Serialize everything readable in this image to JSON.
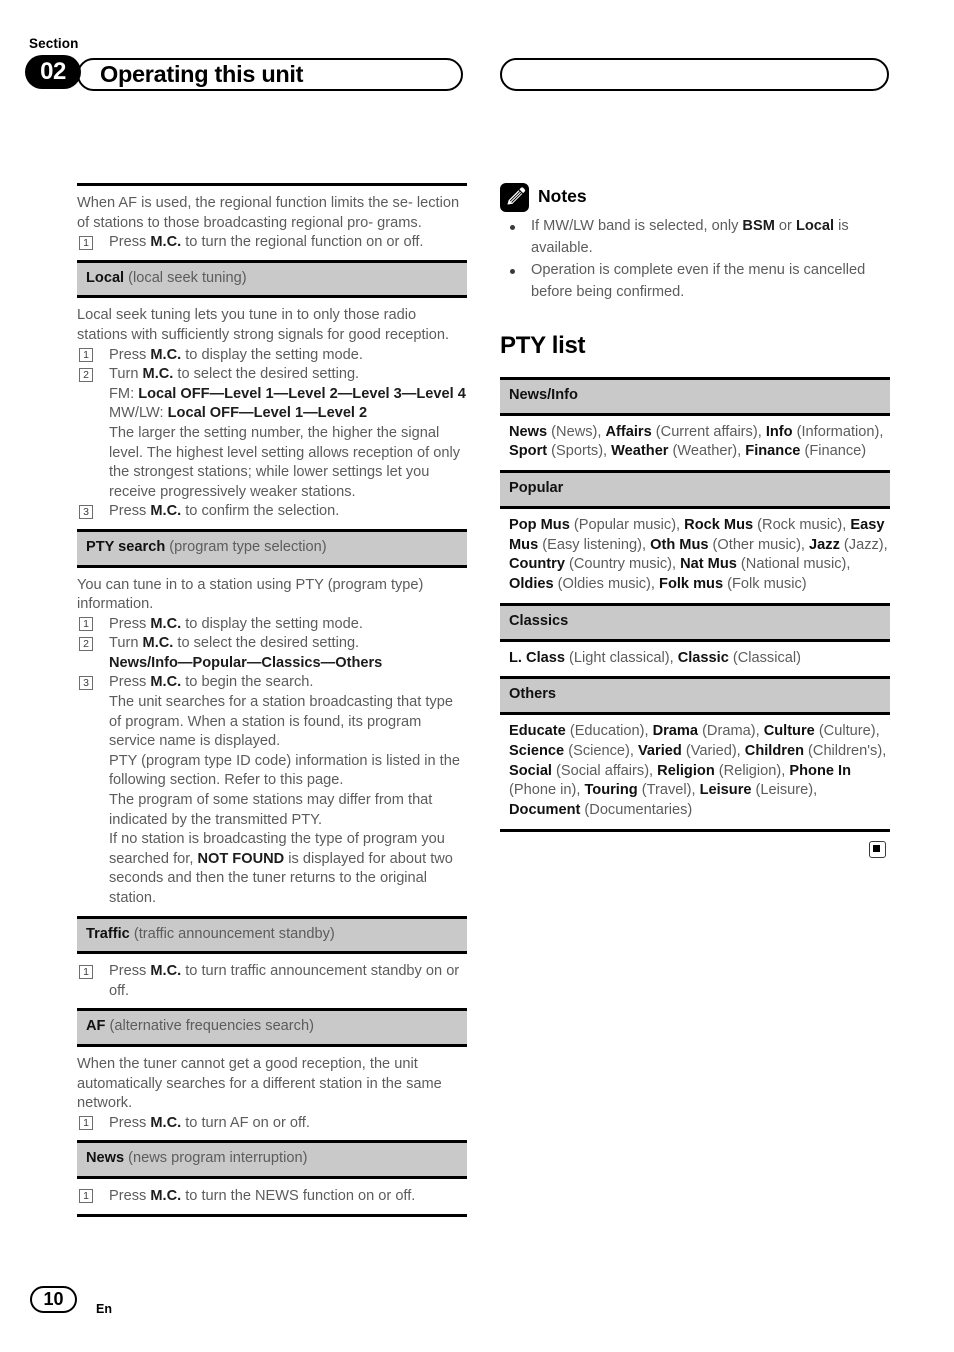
{
  "header": {
    "section_label": "Section",
    "section_number": "02",
    "title": "Operating this unit"
  },
  "footer": {
    "page_number": "10",
    "language": "En"
  },
  "left_column": {
    "intro": {
      "line1": "When AF is used, the regional function limits the se-",
      "line2": "lection of stations to those broadcasting regional pro-",
      "line3": "grams.",
      "step1_num": "1",
      "step1_pre": "Press ",
      "step1_bold": "M.C.",
      "step1_post": " to turn the regional function on or off."
    },
    "local": {
      "bar_title": "Local",
      "bar_sub": " (local seek tuning)",
      "para": "Local seek tuning lets you tune in to only those radio stations with sufficiently strong signals for good reception.",
      "step1_num": "1",
      "step1_pre": "Press ",
      "step1_bold": "M.C.",
      "step1_post": " to display the setting mode.",
      "step2_num": "2",
      "step2_pre": "Turn ",
      "step2_bold": "M.C.",
      "step2_post": " to select the desired setting.",
      "fm_label": "FM: ",
      "fm_values": "Local OFF—Level 1—Level 2—Level 3—Level 4",
      "mwlw_label": "MW/LW: ",
      "mwlw_values": "Local OFF—Level 1—Level 2",
      "explain": "The larger the setting number, the higher the signal level. The highest level setting allows reception of only the strongest stations; while lower settings let you receive progressively weaker stations.",
      "step3_num": "3",
      "step3_pre": "Press ",
      "step3_bold": "M.C.",
      "step3_post": " to confirm the selection."
    },
    "pty_search": {
      "bar_title": "PTY search",
      "bar_sub": " (program type selection)",
      "para": "You can tune in to a station using PTY (program type) information.",
      "step1_num": "1",
      "step1_pre": "Press ",
      "step1_bold": "M.C.",
      "step1_post": " to display the setting mode.",
      "step2_num": "2",
      "step2_pre": "Turn ",
      "step2_bold": "M.C.",
      "step2_post": " to select the desired setting.",
      "options": "News/Info—Popular—Classics—Others",
      "step3_num": "3",
      "step3_pre": "Press ",
      "step3_bold": "M.C.",
      "step3_post": " to begin the search.",
      "detail1": "The unit searches for a station broadcasting that type of program. When a station is found, its program service name is displayed.",
      "detail2": "PTY (program type ID code) information is listed in the following section. Refer to this page.",
      "detail3": "The program of some stations may differ from that indicated by the transmitted PTY.",
      "detail4_pre": "If no station is broadcasting the type of program you searched for, ",
      "detail4_bold": "NOT FOUND",
      "detail4_post": " is displayed for about two seconds and then the tuner returns to the original station."
    },
    "traffic": {
      "bar_title": "Traffic",
      "bar_sub": " (traffic announcement standby)",
      "step1_num": "1",
      "step1_pre": "Press ",
      "step1_bold": "M.C.",
      "step1_post": " to turn traffic announcement standby on or off."
    },
    "af": {
      "bar_title": "AF",
      "bar_sub": " (alternative frequencies search)",
      "para": "When the tuner cannot get a good reception, the unit automatically searches for a different station in the same network.",
      "step1_num": "1",
      "step1_pre": "Press ",
      "step1_bold": "M.C.",
      "step1_post": " to turn AF on or off."
    },
    "news": {
      "bar_title": "News",
      "bar_sub": " (news program interruption)",
      "step1_num": "1",
      "step1_pre": "Press ",
      "step1_bold": "M.C.",
      "step1_post": " to turn the NEWS function on or off."
    }
  },
  "right_column": {
    "notes": {
      "icon": "pencil-icon",
      "title": "Notes",
      "bullet1_pre": "If MW/LW band is selected, only ",
      "bullet1_bold1": "BSM",
      "bullet1_mid": " or ",
      "bullet1_bold2": "Local",
      "bullet1_post": " is available.",
      "bullet2": "Operation is complete even if the menu is cancelled before being confirmed."
    },
    "pty_list": {
      "heading": "PTY list",
      "rows": [
        {
          "header": "News/Info",
          "entries": [
            {
              "term": "News",
              "desc": "(News)"
            },
            {
              "term": "Affairs",
              "desc": "(Current affairs)"
            },
            {
              "term": "Info",
              "desc": "(Information)"
            },
            {
              "term": "Sport",
              "desc": "(Sports)"
            },
            {
              "term": "Weather",
              "desc": "(Weather)"
            },
            {
              "term": "Finance",
              "desc": "(Finance)"
            }
          ]
        },
        {
          "header": "Popular",
          "entries": [
            {
              "term": "Pop Mus",
              "desc": "(Popular music)"
            },
            {
              "term": "Rock Mus",
              "desc": "(Rock music)"
            },
            {
              "term": "Easy Mus",
              "desc": "(Easy listening)"
            },
            {
              "term": "Oth Mus",
              "desc": "(Other music)"
            },
            {
              "term": "Jazz",
              "desc": "(Jazz)"
            },
            {
              "term": "Country",
              "desc": "(Country music)"
            },
            {
              "term": "Nat Mus",
              "desc": "(National music)"
            },
            {
              "term": "Oldies",
              "desc": "(Oldies music)"
            },
            {
              "term": "Folk mus",
              "desc": "(Folk music)"
            }
          ]
        },
        {
          "header": "Classics",
          "entries": [
            {
              "term": "L. Class",
              "desc": "(Light classical)"
            },
            {
              "term": "Classic",
              "desc": "(Classical)"
            }
          ]
        },
        {
          "header": "Others",
          "entries": [
            {
              "term": "Educate",
              "desc": "(Education)"
            },
            {
              "term": "Drama",
              "desc": "(Drama)"
            },
            {
              "term": "Culture",
              "desc": "(Culture)"
            },
            {
              "term": "Science",
              "desc": "(Science)"
            },
            {
              "term": "Varied",
              "desc": "(Varied)"
            },
            {
              "term": "Children",
              "desc": "(Children's)"
            },
            {
              "term": "Social",
              "desc": "(Social affairs)"
            },
            {
              "term": "Religion",
              "desc": "(Religion)"
            },
            {
              "term": "Phone In",
              "desc": "(Phone in)"
            },
            {
              "term": "Touring",
              "desc": "(Travel)"
            },
            {
              "term": "Leisure",
              "desc": "(Leisure)"
            },
            {
              "term": "Document",
              "desc": "(Documentaries)"
            }
          ]
        }
      ],
      "end_marker": "end-of-section-marker"
    }
  },
  "colors": {
    "bar_gray": "#c9c9c9",
    "body_text": "#5c5c5c",
    "bold_text": "#111111",
    "rule_black": "#000000"
  }
}
